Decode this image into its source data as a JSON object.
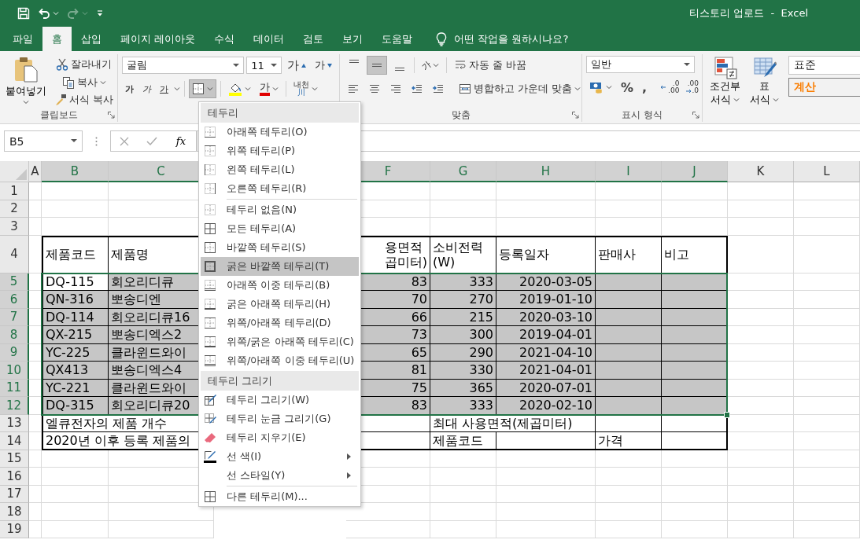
{
  "window": {
    "title": "티스토리 업로드  -  Excel"
  },
  "quick_access": [
    {
      "kind": "save",
      "disabled": false
    },
    {
      "kind": "undo",
      "disabled": false
    },
    {
      "kind": "redo",
      "disabled": true
    },
    {
      "kind": "customize",
      "disabled": false
    }
  ],
  "tabs": [
    {
      "label": "파일",
      "selected": false
    },
    {
      "label": "홈",
      "selected": true
    },
    {
      "label": "삽입",
      "selected": false
    },
    {
      "label": "페이지 레이아웃",
      "selected": false
    },
    {
      "label": "수식",
      "selected": false
    },
    {
      "label": "데이터",
      "selected": false
    },
    {
      "label": "검토",
      "selected": false
    },
    {
      "label": "보기",
      "selected": false
    },
    {
      "label": "도움말",
      "selected": false
    }
  ],
  "tell_me": {
    "placeholder": "어떤 작업을 원하시나요?"
  },
  "ribbon": {
    "clipboard": {
      "label": "클립보드",
      "paste": "붙여넣기",
      "cut": "잘라내기",
      "copy": "복사",
      "format_painter": "서식 복사"
    },
    "font": {
      "name": "굴림",
      "size": "11",
      "grow": "가",
      "shrink": "가",
      "bold": "가",
      "italic": "가",
      "underline": "가",
      "font_color": "가",
      "phonetic": "내천",
      "phonetic_mark": "川",
      "borders_open": true
    },
    "alignment": {
      "label": "맞춤",
      "orientation": "가",
      "wrap_text": "자동 줄 바꿈",
      "merge": "병합하고 가운데 맞춤",
      "vertical": [
        {
          "kind": "top",
          "selected": false
        },
        {
          "kind": "middle",
          "selected": true
        },
        {
          "kind": "bottom",
          "selected": false
        }
      ],
      "horizontal": [
        {
          "kind": "left",
          "selected": false
        },
        {
          "kind": "center",
          "selected": false
        },
        {
          "kind": "right",
          "selected": false
        }
      ]
    },
    "number": {
      "label": "표시 형식",
      "format": "일반",
      "percent": "%",
      "comma": ",",
      "increase_decimal": [
        ".0",
        ".00"
      ],
      "decrease_decimal": [
        ".00",
        ".0"
      ]
    },
    "styles": {
      "conditional": [
        "조건부",
        "서식"
      ],
      "table": [
        "표",
        "서식"
      ],
      "cells": [
        {
          "label": "표준",
          "kind": "normal"
        },
        {
          "label": "계산",
          "kind": "calculation"
        }
      ]
    }
  },
  "name_box": "B5",
  "formula_bar": {
    "function_label": "fx"
  },
  "sheet": {
    "columns": [
      {
        "label": "A",
        "selected": false
      },
      {
        "label": "B",
        "selected": true
      },
      {
        "label": "C",
        "selected": true
      },
      {
        "label": "F",
        "selected": true
      },
      {
        "label": "G",
        "selected": true
      },
      {
        "label": "H",
        "selected": true
      },
      {
        "label": "I",
        "selected": true
      },
      {
        "label": "J",
        "selected": true
      },
      {
        "label": "K",
        "selected": false
      },
      {
        "label": "L",
        "selected": false
      }
    ],
    "rows": [
      {
        "label": "1",
        "selected": false
      },
      {
        "label": "2",
        "selected": false
      },
      {
        "label": "3",
        "selected": false
      },
      {
        "label": "4",
        "selected": false,
        "cells": [
          null,
          {
            "text": "제품코드",
            "kind": "text"
          },
          {
            "text": "제품명",
            "kind": "text"
          },
          {
            "text": "용면적\n곱미터)",
            "kind": "clipped"
          },
          {
            "text": "소비전력\n(W)",
            "kind": "text"
          },
          {
            "text": "등록일자",
            "kind": "text"
          },
          {
            "text": "판매사",
            "kind": "text"
          },
          {
            "text": "비고",
            "kind": "text"
          },
          null,
          null
        ]
      },
      {
        "label": "5",
        "selected": true,
        "cells": [
          null,
          {
            "text": "DQ-115",
            "kind": "text",
            "active": true
          },
          {
            "text": "회오리디큐",
            "kind": "text"
          },
          {
            "text": "83",
            "kind": "number"
          },
          {
            "text": "333",
            "kind": "number"
          },
          {
            "text": "2020-03-05",
            "kind": "number"
          },
          {
            "kind": "blank"
          },
          {
            "kind": "blank"
          },
          null,
          null
        ]
      },
      {
        "label": "6",
        "selected": true,
        "cells": [
          null,
          {
            "text": "QN-316",
            "kind": "text"
          },
          {
            "text": "뽀송디엔",
            "kind": "text"
          },
          {
            "text": "70",
            "kind": "number"
          },
          {
            "text": "270",
            "kind": "number"
          },
          {
            "text": "2019-01-10",
            "kind": "number"
          },
          {
            "kind": "blank"
          },
          {
            "kind": "blank"
          },
          null,
          null
        ]
      },
      {
        "label": "7",
        "selected": true,
        "cells": [
          null,
          {
            "text": "DQ-114",
            "kind": "text"
          },
          {
            "text": "회오리디큐16",
            "kind": "text"
          },
          {
            "text": "66",
            "kind": "number"
          },
          {
            "text": "215",
            "kind": "number"
          },
          {
            "text": "2020-03-10",
            "kind": "number"
          },
          {
            "kind": "blank"
          },
          {
            "kind": "blank"
          },
          null,
          null
        ]
      },
      {
        "label": "8",
        "selected": true,
        "cells": [
          null,
          {
            "text": "QX-215",
            "kind": "text"
          },
          {
            "text": "뽀송디엑스2",
            "kind": "text"
          },
          {
            "text": "73",
            "kind": "number"
          },
          {
            "text": "300",
            "kind": "number"
          },
          {
            "text": "2019-04-01",
            "kind": "number"
          },
          {
            "kind": "blank"
          },
          {
            "kind": "blank"
          },
          null,
          null
        ]
      },
      {
        "label": "9",
        "selected": true,
        "cells": [
          null,
          {
            "text": "YC-225",
            "kind": "text"
          },
          {
            "text": "클라윈드와이",
            "kind": "text"
          },
          {
            "text": "65",
            "kind": "number"
          },
          {
            "text": "290",
            "kind": "number"
          },
          {
            "text": "2021-04-10",
            "kind": "number"
          },
          {
            "kind": "blank"
          },
          {
            "kind": "blank"
          },
          null,
          null
        ]
      },
      {
        "label": "10",
        "selected": true,
        "cells": [
          null,
          {
            "text": "QX413",
            "kind": "text"
          },
          {
            "text": "뽀송디엑스4",
            "kind": "text"
          },
          {
            "text": "81",
            "kind": "number"
          },
          {
            "text": "330",
            "kind": "number"
          },
          {
            "text": "2021-04-01",
            "kind": "number"
          },
          {
            "kind": "blank"
          },
          {
            "kind": "blank"
          },
          null,
          null
        ]
      },
      {
        "label": "11",
        "selected": true,
        "cells": [
          null,
          {
            "text": "YC-221",
            "kind": "text"
          },
          {
            "text": "클라윈드와이",
            "kind": "text"
          },
          {
            "text": "75",
            "kind": "number"
          },
          {
            "text": "365",
            "kind": "number"
          },
          {
            "text": "2020-07-01",
            "kind": "number"
          },
          {
            "kind": "blank"
          },
          {
            "kind": "blank"
          },
          null,
          null
        ]
      },
      {
        "label": "12",
        "selected": true,
        "cells": [
          null,
          {
            "text": "DQ-315",
            "kind": "text"
          },
          {
            "text": "회오리디큐20",
            "kind": "text"
          },
          {
            "text": "83",
            "kind": "number"
          },
          {
            "text": "333",
            "kind": "number"
          },
          {
            "text": "2020-02-10",
            "kind": "number"
          },
          {
            "kind": "blank"
          },
          {
            "kind": "blank"
          },
          null,
          null
        ]
      },
      {
        "label": "13",
        "selected": false,
        "cells": [
          null,
          {
            "text": "엘큐전자의 제품 개수",
            "kind": "text"
          },
          {
            "merged": true
          },
          {
            "merged": true
          },
          {
            "text": "최대 사용면적(제곱미터)",
            "kind": "text"
          },
          {
            "merged": true
          },
          {
            "kind": "blank"
          },
          {
            "kind": "blank"
          },
          null,
          null
        ]
      },
      {
        "label": "14",
        "selected": false,
        "cells": [
          null,
          {
            "text": "2020년 이후 등록 제품의",
            "kind": "text"
          },
          {
            "merged": true
          },
          {
            "merged": true
          },
          {
            "text": "제품코드",
            "kind": "text"
          },
          {
            "kind": "blank"
          },
          {
            "text": "가격",
            "kind": "text"
          },
          {
            "kind": "blank"
          },
          null,
          null
        ]
      },
      {
        "label": "15",
        "selected": false
      },
      {
        "label": "16",
        "selected": false
      },
      {
        "label": "17",
        "selected": false
      },
      {
        "label": "18",
        "selected": false
      },
      {
        "label": "19",
        "selected": false
      }
    ]
  },
  "borders_menu": {
    "sections": [
      {
        "header": "테두리",
        "groups": [
          [
            {
              "label": "아래쪽 테두리(O)",
              "kind": "bottom",
              "selected": false,
              "submenu": false
            },
            {
              "label": "위쪽 테두리(P)",
              "kind": "top",
              "selected": false,
              "submenu": false
            },
            {
              "label": "왼쪽 테두리(L)",
              "kind": "left",
              "selected": false,
              "submenu": false
            },
            {
              "label": "오른쪽 테두리(R)",
              "kind": "right",
              "selected": false,
              "submenu": false
            }
          ],
          [
            {
              "label": "테두리 없음(N)",
              "kind": "none",
              "selected": false,
              "submenu": false
            },
            {
              "label": "모든 테두리(A)",
              "kind": "all",
              "selected": false,
              "submenu": false
            },
            {
              "label": "바깥쪽 테두리(S)",
              "kind": "outside",
              "selected": false,
              "submenu": false
            },
            {
              "label": "굵은 바깥쪽 테두리(T)",
              "kind": "thick_outside",
              "selected": true,
              "submenu": false
            },
            {
              "label": "아래쪽 이중 테두리(B)",
              "kind": "bottom_double",
              "selected": false,
              "submenu": false
            },
            {
              "label": "굵은 아래쪽 테두리(H)",
              "kind": "thick_bottom",
              "selected": false,
              "submenu": false
            },
            {
              "label": "위쪽/아래쪽 테두리(D)",
              "kind": "top_bottom",
              "selected": false,
              "submenu": false
            },
            {
              "label": "위쪽/굵은 아래쪽 테두리(C)",
              "kind": "top_thick_bottom",
              "selected": false,
              "submenu": false
            },
            {
              "label": "위쪽/아래쪽 이중 테두리(U)",
              "kind": "top_double_bottom",
              "selected": false,
              "submenu": false
            }
          ]
        ]
      },
      {
        "header": "테두리 그리기",
        "groups": [
          [
            {
              "label": "테두리 그리기(W)",
              "kind": "draw",
              "selected": false,
              "submenu": false
            },
            {
              "label": "테두리 눈금 그리기(G)",
              "kind": "draw_grid",
              "selected": false,
              "submenu": false
            },
            {
              "label": "테두리 지우기(E)",
              "kind": "erase",
              "selected": false,
              "submenu": false
            },
            {
              "label": "선 색(I)",
              "kind": "line_color",
              "selected": false,
              "submenu": true
            },
            {
              "label": "선 스타일(Y)",
              "kind": "line_style",
              "selected": false,
              "submenu": true
            }
          ],
          [
            {
              "label": "다른 테두리(M)...",
              "kind": "more",
              "selected": false,
              "submenu": false
            }
          ]
        ]
      }
    ]
  }
}
